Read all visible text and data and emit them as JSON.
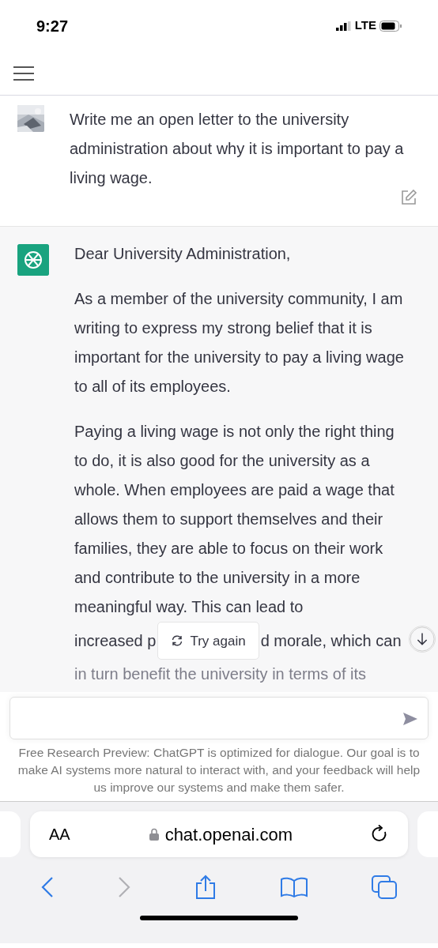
{
  "status_bar": {
    "time": "9:27",
    "network": "LTE"
  },
  "user_message": {
    "text": "Write me an open letter to the university administration about why it is important to pay a living wage."
  },
  "assistant_message": {
    "paragraphs": [
      "Dear University Administration,",
      "As a member of the university community, I am writing to express my strong belief that it is important for the university to pay a living wage to all of its employees.",
      "Paying a living wage is not only the right thing to do, it is also good for the university as a whole. When employees are paid a wage that allows them to support themselves and their families, they are able to focus on their work and contribute to the university in a more meaningful way. This can lead to"
    ],
    "covered_line": {
      "before": "increased p",
      "after": "d morale, which can"
    },
    "faded_line": "in turn benefit the university in terms of its"
  },
  "try_again_button": "Try again",
  "disclaimer": "Free Research Preview: ChatGPT is optimized for dialogue. Our goal is to make AI systems more natural to interact with, and your feedback will help us improve our systems and make them safer.",
  "browser": {
    "text_size_button": "AA",
    "url": "chat.openai.com",
    "forward_disabled": true
  }
}
